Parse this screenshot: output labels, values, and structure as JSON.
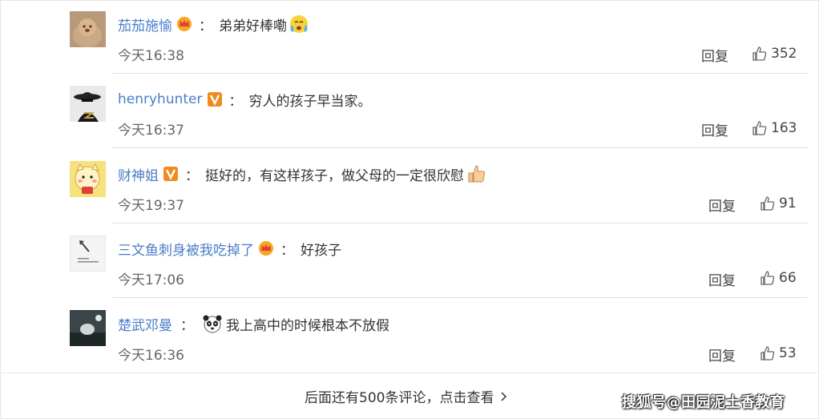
{
  "comments": [
    {
      "username": "茄茄施愉",
      "badge": "crown",
      "text": "弟弟好棒嘞",
      "emoji": "tearful-cry-emoji",
      "time": "今天16:38",
      "reply": "回复",
      "likes": "352"
    },
    {
      "username": "henryhunter",
      "badge": "v",
      "text": "穷人的孩子早当家。",
      "emoji": "",
      "time": "今天16:37",
      "reply": "回复",
      "likes": "163"
    },
    {
      "username": "财神姐",
      "badge": "v",
      "text": "挺好的，有这样孩子，做父母的一定很欣慰",
      "emoji": "thumbs-up-emoji",
      "time": "今天19:37",
      "reply": "回复",
      "likes": "91"
    },
    {
      "username": "三文鱼刺身被我吃掉了",
      "badge": "crown",
      "text": "好孩子",
      "emoji": "",
      "time": "今天17:06",
      "reply": "回复",
      "likes": "66"
    },
    {
      "username": "楚武邓曼",
      "badge": "",
      "text": "我上高中的时候根本不放假",
      "emoji": "panda-emoji",
      "time": "今天16:36",
      "reply": "回复",
      "likes": "53"
    }
  ],
  "footer": {
    "more_text": "后面还有500条评论，点击查看",
    "watermark": "搜狐号@田园泥土香教育"
  },
  "colors": {
    "username": "#4a7dc7",
    "crown": "#f5a623",
    "vbadge": "#f08a1c"
  }
}
